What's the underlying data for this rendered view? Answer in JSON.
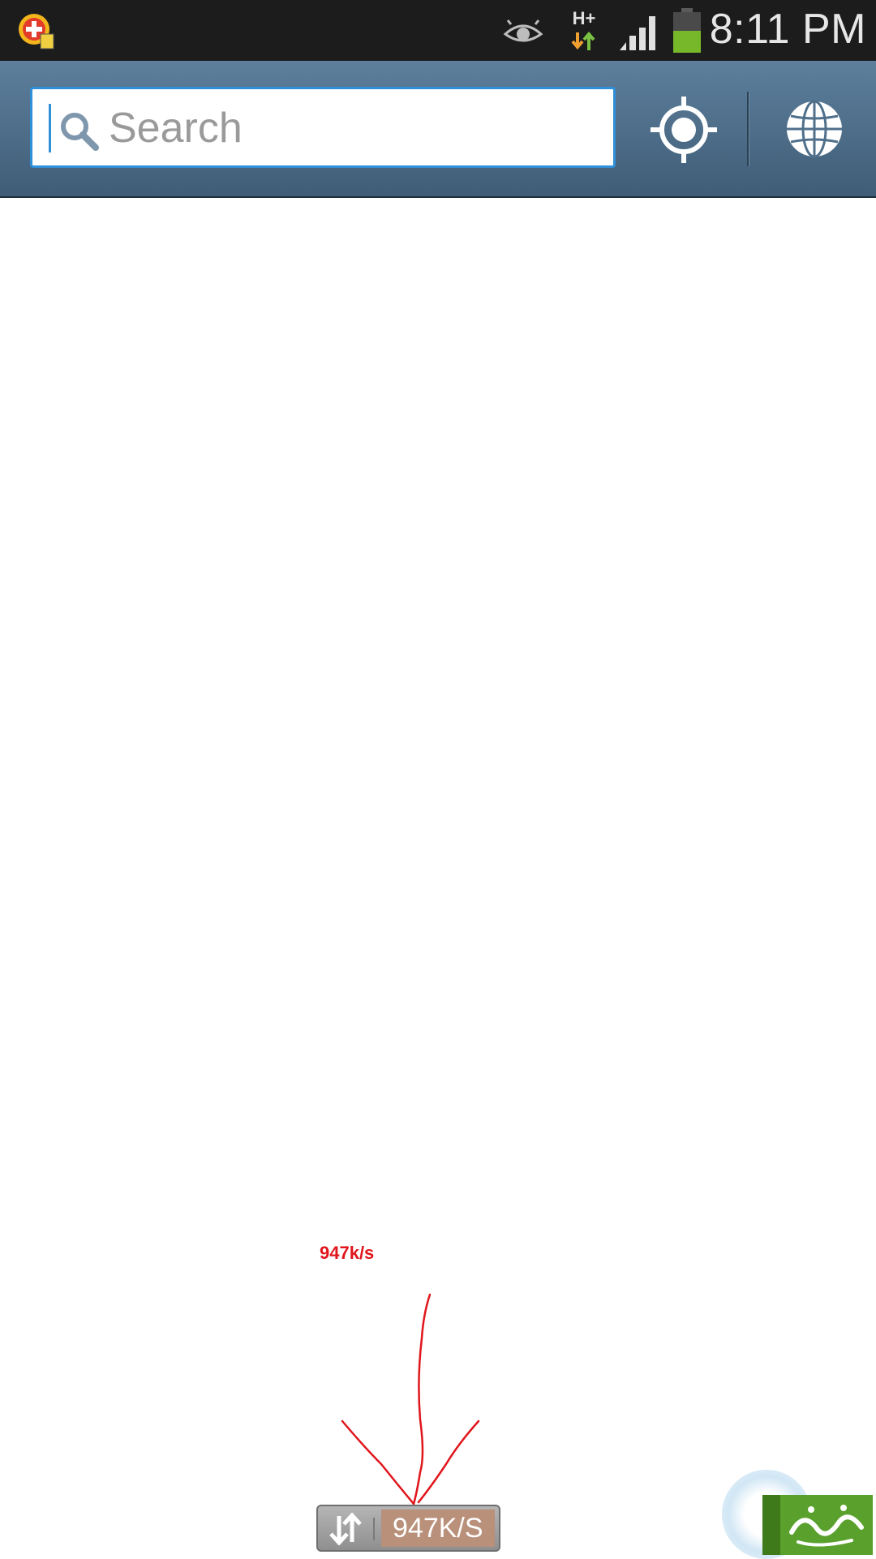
{
  "status_bar": {
    "time": "8:11 PM",
    "network_type": "H+",
    "icons": [
      "app-plus-icon",
      "eye-icon",
      "network-arrows-icon",
      "signal-icon",
      "battery-icon"
    ],
    "battery_level": 0.55
  },
  "search": {
    "placeholder": "Search",
    "value": ""
  },
  "header_actions": [
    "locate-icon",
    "globe-icon"
  ],
  "annotation": {
    "text": "947k/s",
    "color": "#e0161c"
  },
  "speed_widget": {
    "value": "947K/S"
  },
  "colors": {
    "header": "#4f6f8b",
    "search_border": "#2f8fd8",
    "battery": "#76b82a"
  }
}
